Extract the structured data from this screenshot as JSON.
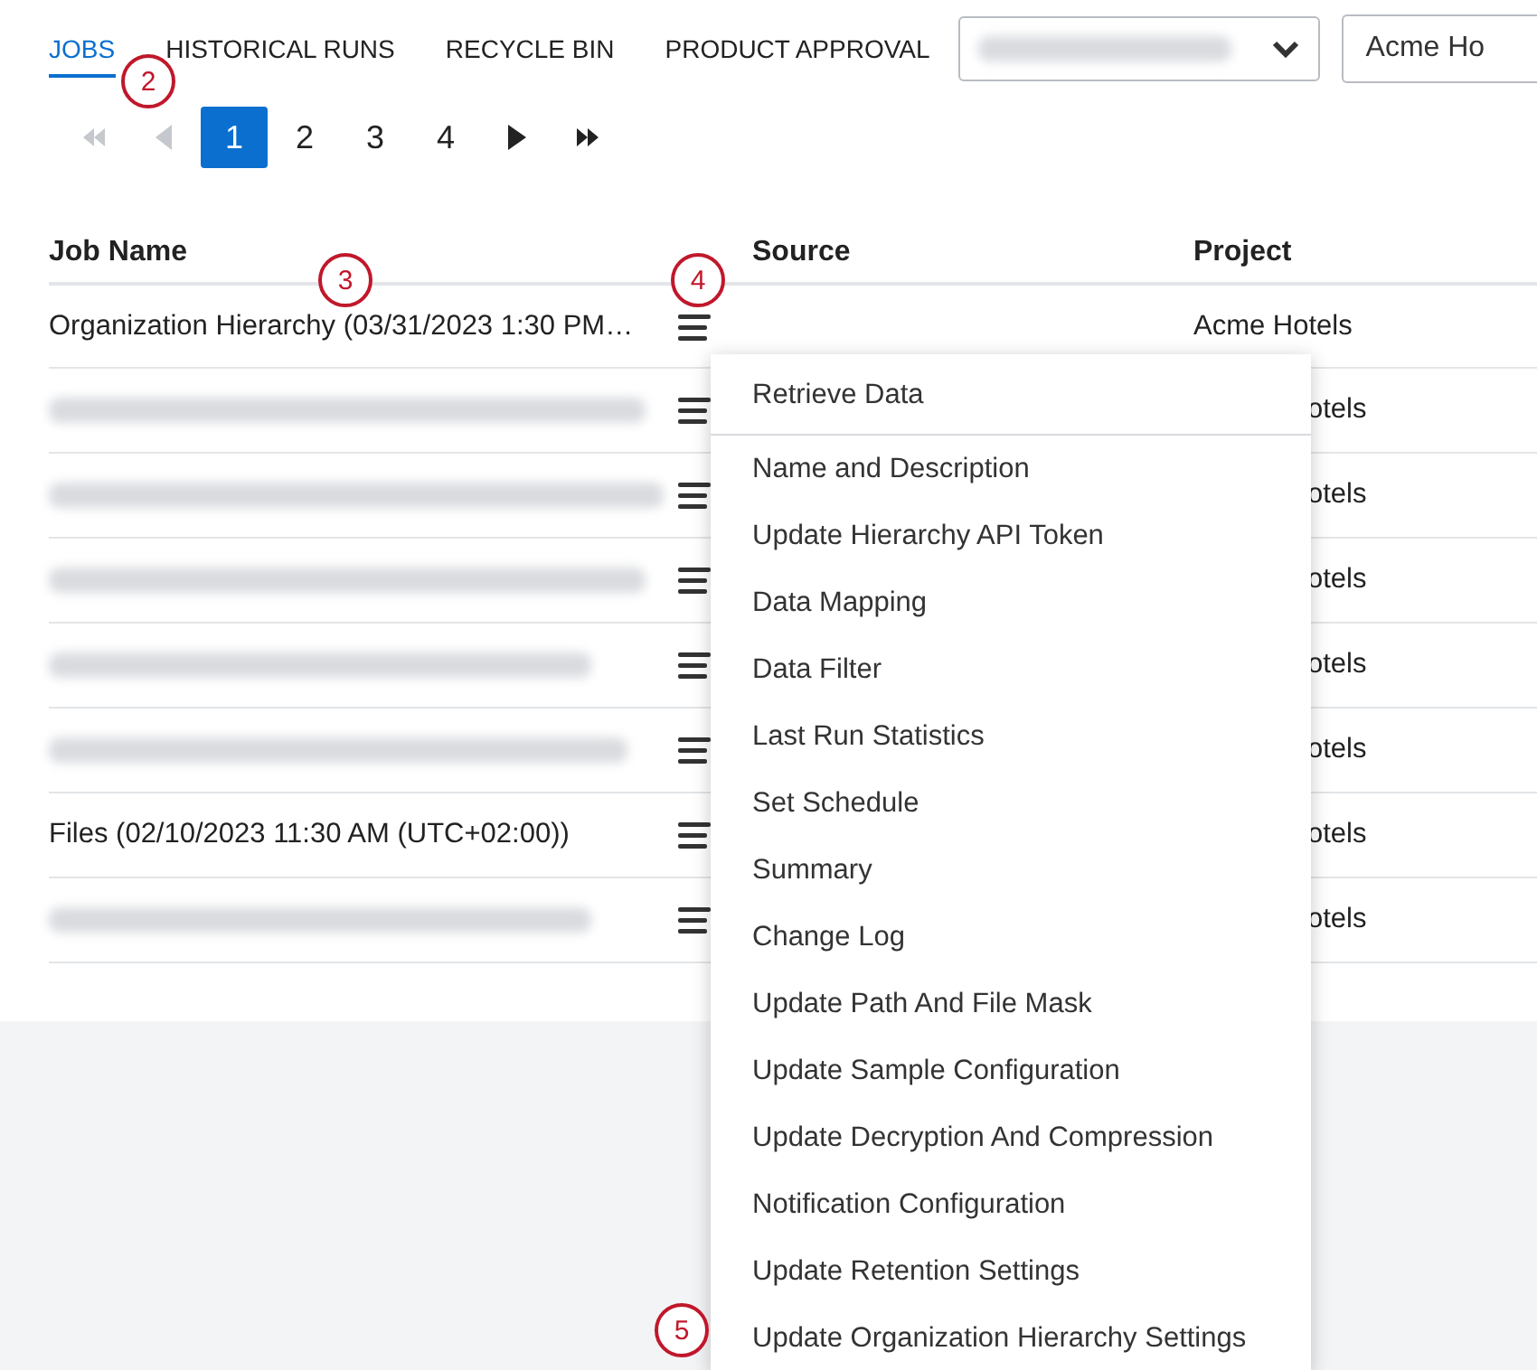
{
  "tabs": [
    {
      "label": "JOBS",
      "selected": true
    },
    {
      "label": "HISTORICAL RUNS",
      "selected": false
    },
    {
      "label": "RECYCLE BIN",
      "selected": false
    },
    {
      "label": "PRODUCT APPROVAL",
      "selected": false
    }
  ],
  "account_select": {
    "kind": "redacted"
  },
  "project_select": {
    "value": "Acme Ho"
  },
  "pagination": {
    "pages": [
      {
        "label": "1",
        "selected": true
      },
      {
        "label": "2",
        "selected": false
      },
      {
        "label": "3",
        "selected": false
      },
      {
        "label": "4",
        "selected": false
      }
    ]
  },
  "table": {
    "columns": [
      "Job Name",
      "",
      "Source",
      "Project"
    ],
    "rows": [
      {
        "kind": "text",
        "name": "Organization Hierarchy (03/31/2023 1:30 PM…",
        "project": "Acme Hotels"
      },
      {
        "kind": "redacted",
        "project": "otels",
        "project_covered": true
      },
      {
        "kind": "redacted",
        "project": "otels",
        "project_covered": true
      },
      {
        "kind": "redacted",
        "project": "otels",
        "project_covered": true
      },
      {
        "kind": "redacted",
        "project": "otels",
        "project_covered": true
      },
      {
        "kind": "redacted",
        "project": "otels",
        "project_covered": true
      },
      {
        "kind": "text",
        "name": "Files (02/10/2023 11:30 AM (UTC+02:00))",
        "project": "otels",
        "project_covered": true
      },
      {
        "kind": "redacted",
        "project": "otels",
        "project_covered": true
      }
    ]
  },
  "row_menu": {
    "items": [
      {
        "label": "Retrieve Data",
        "divider_after": true
      },
      {
        "label": "Name and Description",
        "divider_after": false
      },
      {
        "label": "Update Hierarchy API Token",
        "divider_after": false
      },
      {
        "label": "Data Mapping",
        "divider_after": false
      },
      {
        "label": "Data Filter",
        "divider_after": false
      },
      {
        "label": "Last Run Statistics",
        "divider_after": false
      },
      {
        "label": "Set Schedule",
        "divider_after": false
      },
      {
        "label": "Summary",
        "divider_after": false
      },
      {
        "label": "Change Log",
        "divider_after": false
      },
      {
        "label": "Update Path And File Mask",
        "divider_after": false
      },
      {
        "label": "Update Sample Configuration",
        "divider_after": false
      },
      {
        "label": "Update Decryption And Compression",
        "divider_after": false
      },
      {
        "label": "Notification Configuration",
        "divider_after": false
      },
      {
        "label": "Update Retention Settings",
        "divider_after": false
      },
      {
        "label": "Update Organization Hierarchy Settings",
        "divider_after": false
      }
    ]
  },
  "callouts": [
    "2",
    "3",
    "4",
    "5"
  ]
}
